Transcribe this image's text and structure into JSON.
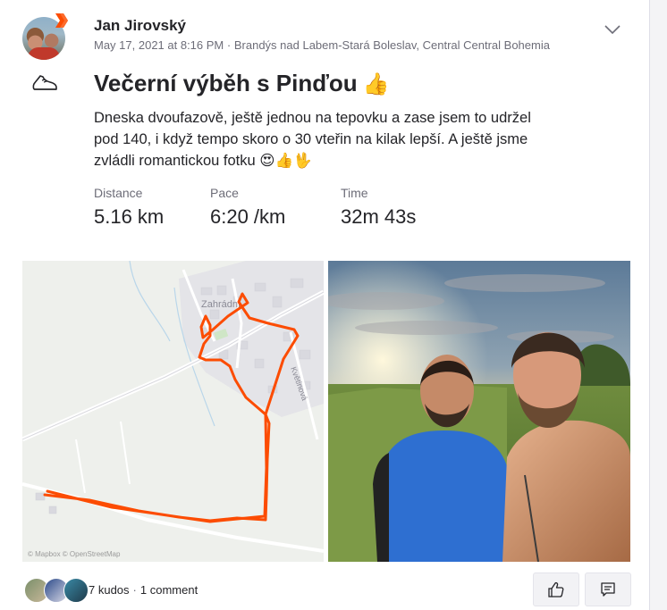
{
  "post": {
    "athlete_name": "Jan Jirovský",
    "timestamp": "May 17, 2021 at 8:16 PM",
    "separator": "·",
    "location": "Brandýs nad Labem-Stará Boleslav, Central Central Bohemia",
    "title": "Večerní výběh s Pinďou",
    "title_emoji": "👍",
    "description": "Dneska dvoufazově, ještě jednou na tepovku a zase jsem to udržel pod 140, i když tempo skoro o 30 vteřin na kilak lepší. A ještě jsme zvládli romantickou fotku 😍👍🖖"
  },
  "stats": [
    {
      "label": "Distance",
      "value": "5.16 km"
    },
    {
      "label": "Pace",
      "value": "6:20 /km"
    },
    {
      "label": "Time",
      "value": "32m 43s"
    }
  ],
  "map": {
    "attribution": "© Mapbox © OpenStreetMap",
    "place_label": "Zahrádní",
    "street_label": "Květinová",
    "route_color": "#fc4c02"
  },
  "footer": {
    "kudos": "7 kudos",
    "separator": "·",
    "comments": "1 comment"
  },
  "icons": {
    "shoe": "running-shoe-icon",
    "chevron": "chevron-down-icon",
    "kudos": "thumbs-up-icon",
    "comment": "comment-icon"
  },
  "colors": {
    "brand": "#fc4c02",
    "text": "#242428",
    "muted": "#6d6d78"
  }
}
